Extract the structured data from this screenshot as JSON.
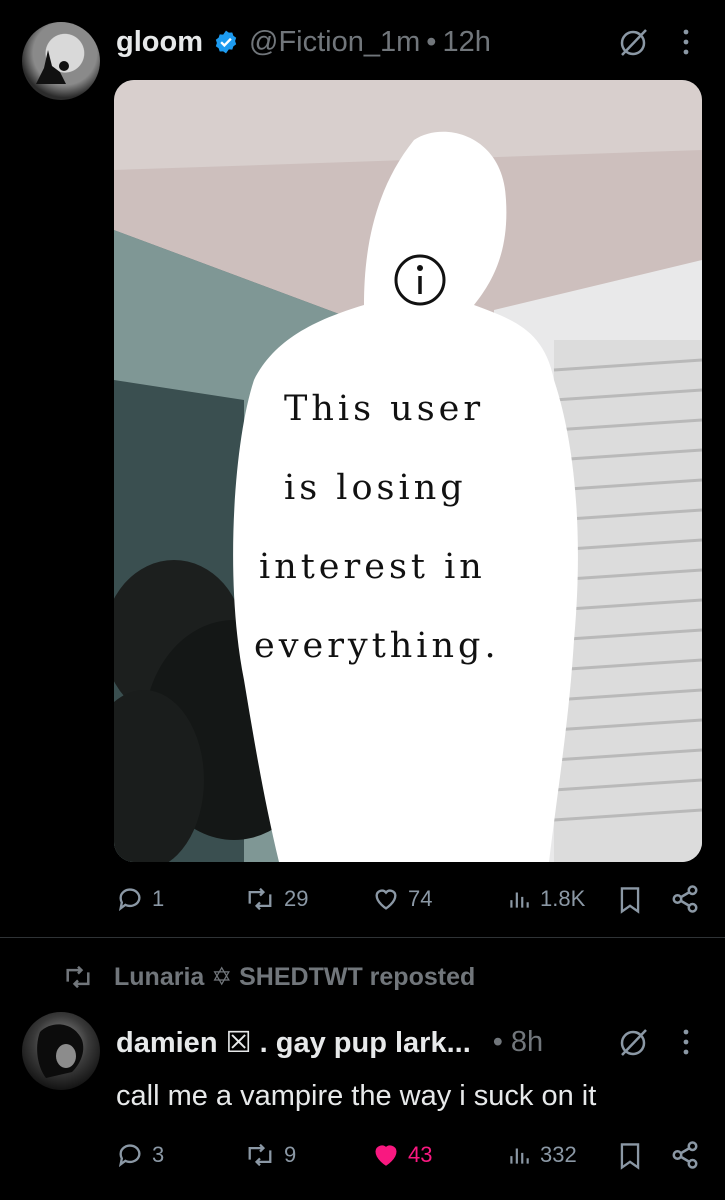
{
  "tweet1": {
    "display_name": "gloom",
    "handle": "@Fiction_1m",
    "separator": "•",
    "time": "12h",
    "image_text": {
      "line1": "This user",
      "line2": "is losing",
      "line3": "interest in",
      "line4": "everything."
    },
    "actions": {
      "replies": "1",
      "reposts": "29",
      "likes": "74",
      "views": "1.8K"
    }
  },
  "repost_banner": {
    "text": "Lunaria ✡ SHEDTWT reposted"
  },
  "tweet2": {
    "display_name": "damien ☒ . gay pup lark...",
    "separator": "•",
    "time": "8h",
    "text": "call me a vampire the way i suck on it",
    "actions": {
      "replies": "3",
      "reposts": "9",
      "likes": "43",
      "views": "332"
    }
  },
  "colors": {
    "like_active": "#f91880",
    "verified": "#1d9bf0",
    "muted": "#71767b"
  }
}
